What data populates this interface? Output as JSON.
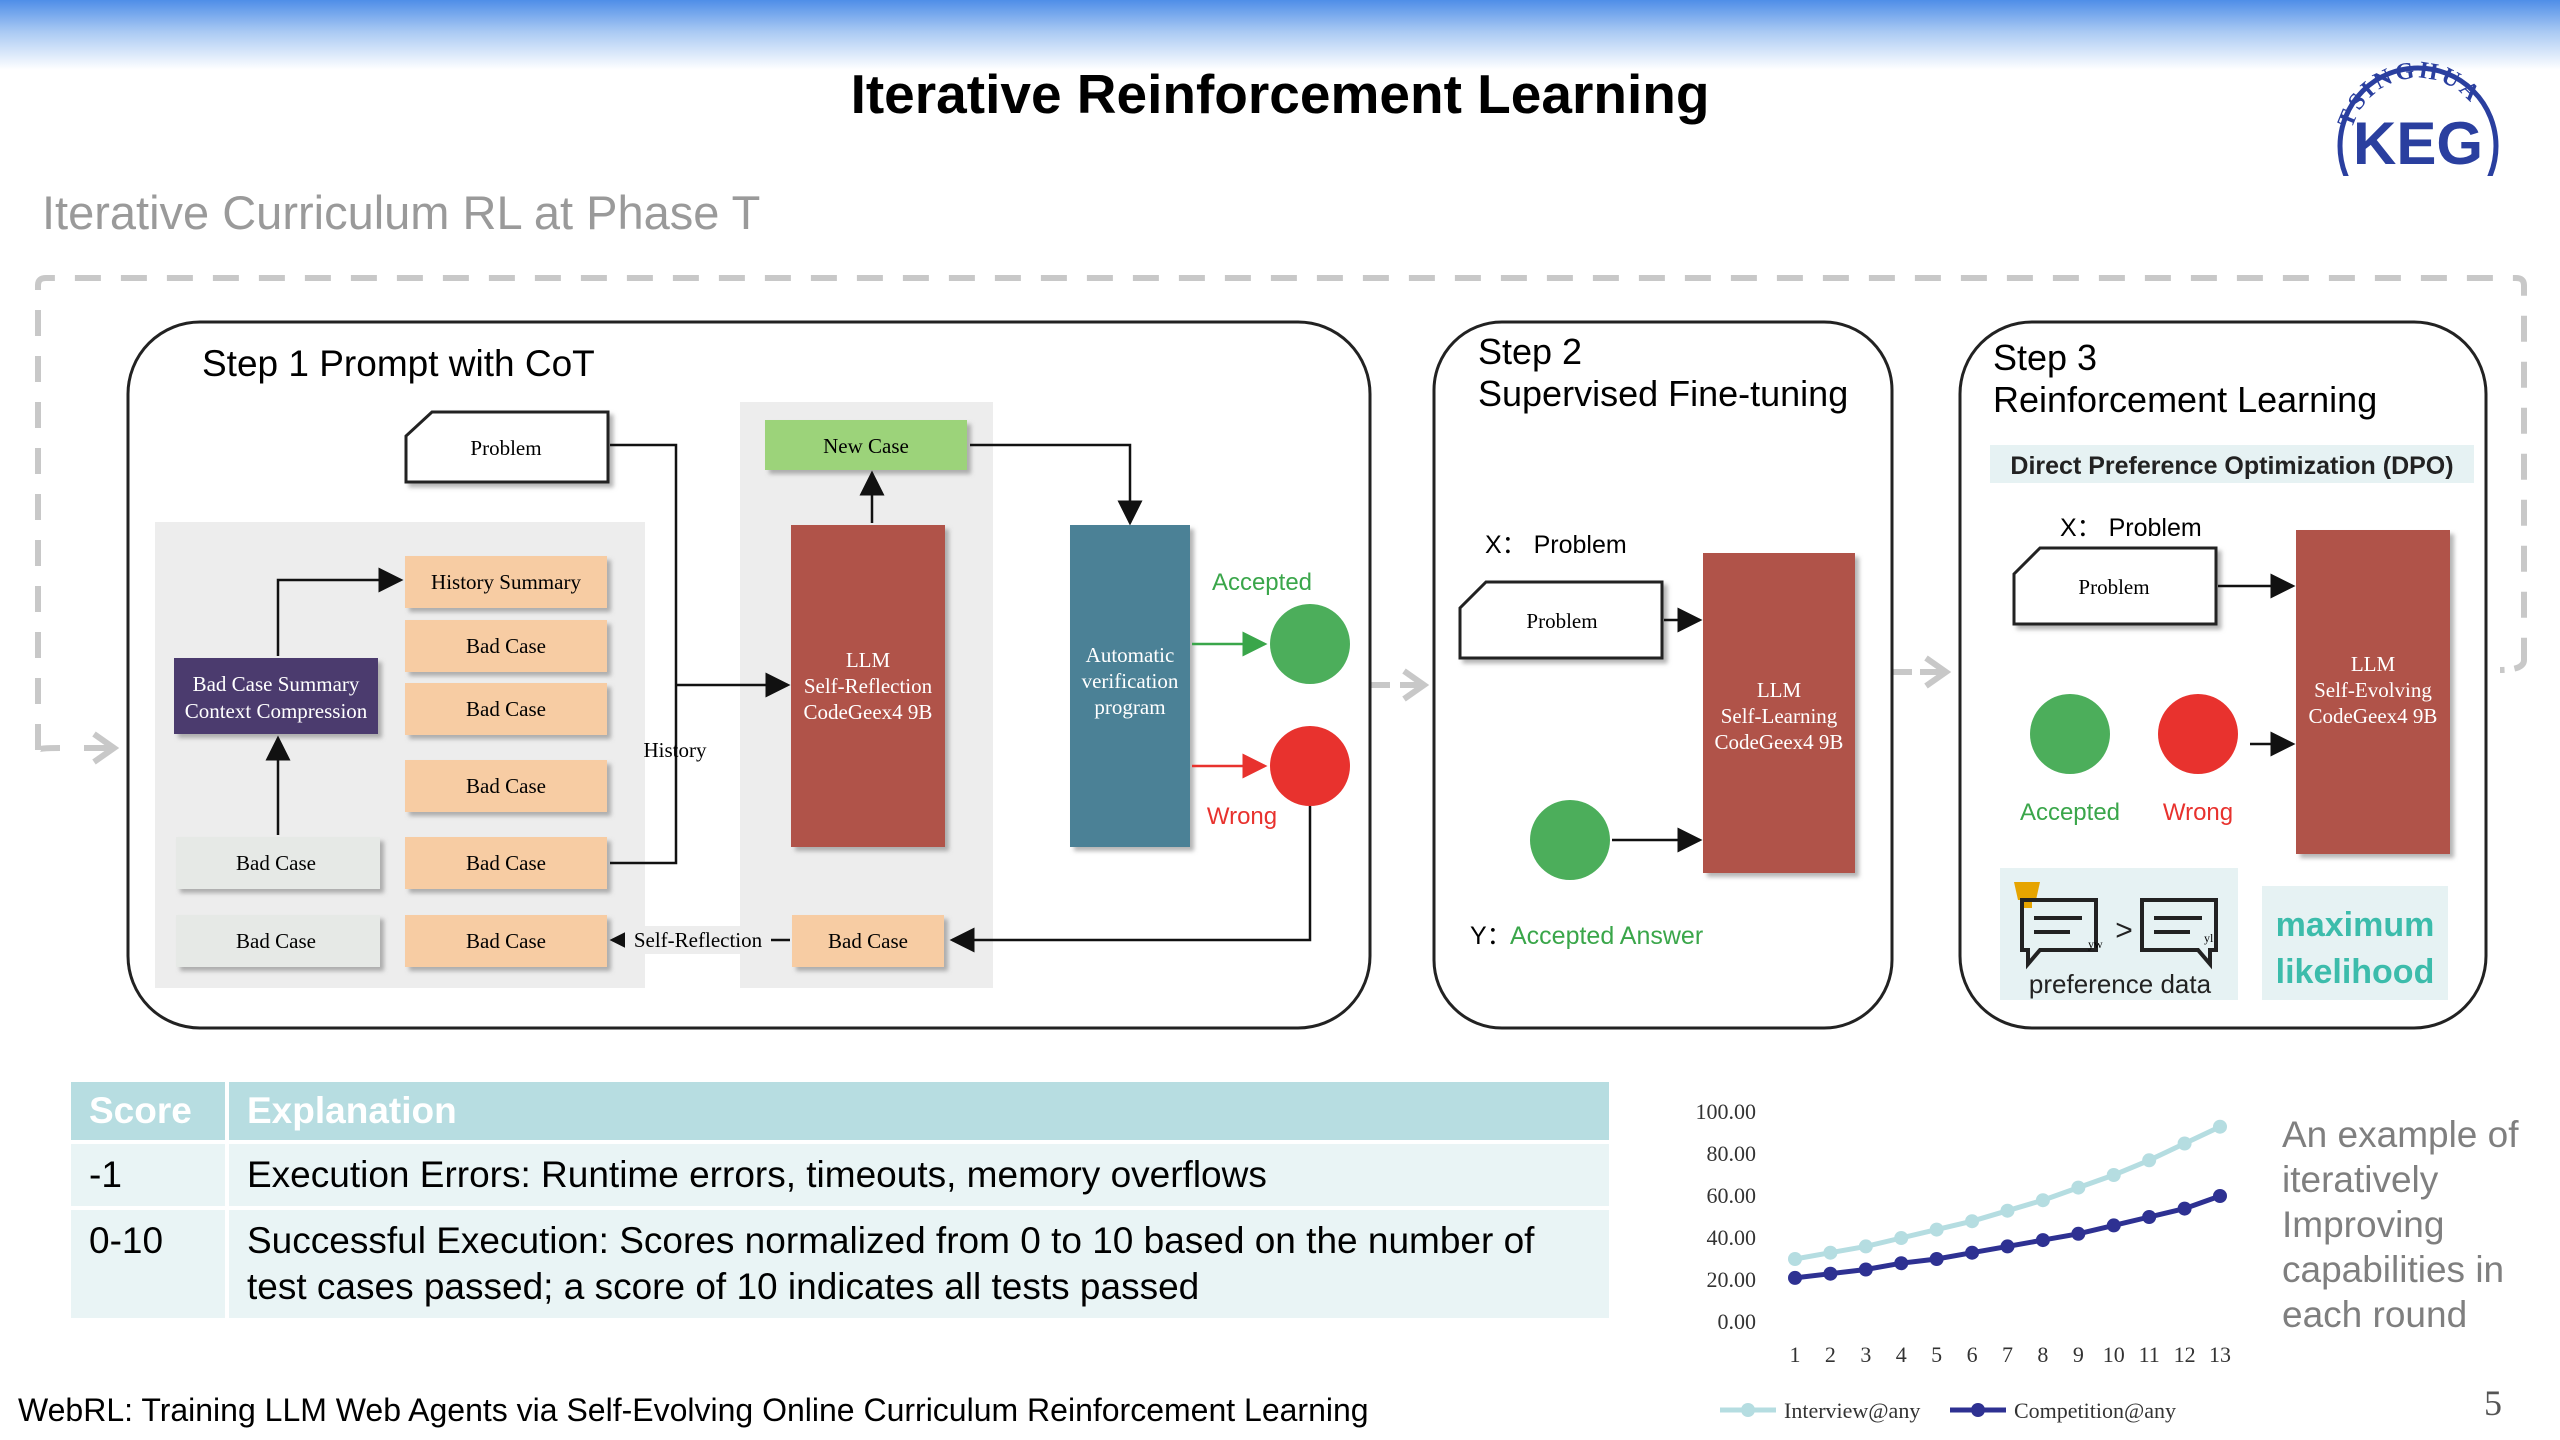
{
  "slide": {
    "title": "Iterative Reinforcement Learning",
    "subtitle": "Iterative Curriculum RL at Phase T",
    "logo_text": "TSINGHUA",
    "logo_mark": "KEG",
    "footer": "WebRL: Training LLM Web Agents via Self-Evolving Online Curriculum Reinforcement Learning",
    "page_number": "5"
  },
  "diagram": {
    "step1": {
      "title": "Step 1  Prompt with CoT",
      "problem": "Problem",
      "history_summary": "History Summary",
      "bad_case": "Bad Case",
      "summary_box_line1": "Bad Case Summary",
      "summary_box_line2": "Context Compression",
      "history_label": "History",
      "new_case": "New Case",
      "llm_line1": "LLM",
      "llm_line2": "Self-Reflection",
      "llm_line3": "CodeGeex4 9B",
      "verify_line1": "Automatic",
      "verify_line2": "verification",
      "verify_line3": "program",
      "accepted": "Accepted",
      "wrong": "Wrong",
      "self_reflection": "Self-Reflection"
    },
    "step2": {
      "title_line1": "Step 2",
      "title_line2": "Supervised Fine-tuning",
      "x_label": "X： Problem",
      "problem": "Problem",
      "llm_line1": "LLM",
      "llm_line2": "Self-Learning",
      "llm_line3": "CodeGeex4 9B",
      "y_prefix": "Y：",
      "y_value": "Accepted Answer"
    },
    "step3": {
      "title_line1": "Step 3",
      "title_line2": "Reinforcement Learning",
      "dpo_label": "Direct Preference Optimization (DPO)",
      "x_label": "X： Problem",
      "problem": "Problem",
      "llm_line1": "LLM",
      "llm_line2": "Self-Evolving",
      "llm_line3": "CodeGeex4 9B",
      "accepted": "Accepted",
      "wrong": "Wrong",
      "pref_label": "preference data",
      "yw": "yw",
      "yl": "yl",
      "ml_line1": "maximum",
      "ml_line2": "likelihood"
    },
    "colors": {
      "llm_red": "#b0534a",
      "verify_teal": "#4b8196",
      "new_case_green": "#9cd37a",
      "bad_case_peach": "#f7cca3",
      "summary_purple": "#4b3a6e",
      "accepted_green": "#4cae5b",
      "wrong_red": "#e8322e"
    }
  },
  "table": {
    "headers": [
      "Score",
      "Explanation"
    ],
    "rows": [
      {
        "score": "-1",
        "explanation": "Execution Errors: Runtime errors, timeouts, memory overflows"
      },
      {
        "score": "0-10",
        "explanation": "Successful Execution: Scores normalized from 0 to 10 based on the number of test cases passed; a score of 10 indicates all tests passed"
      }
    ]
  },
  "chart_data": {
    "type": "line",
    "title": "",
    "xlabel": "",
    "ylabel": "",
    "x": [
      1,
      2,
      3,
      4,
      5,
      6,
      7,
      8,
      9,
      10,
      11,
      12,
      13
    ],
    "y_ticks": [
      "0.00",
      "20.00",
      "40.00",
      "60.00",
      "80.00",
      "100.00"
    ],
    "ylim": [
      0,
      100
    ],
    "grid": false,
    "legend": "bottom",
    "series": [
      {
        "name": "Interview@any",
        "color": "#b5dde1",
        "values": [
          30,
          33,
          36,
          40,
          44,
          48,
          53,
          58,
          64,
          70,
          77,
          85,
          93
        ]
      },
      {
        "name": "Competition@any",
        "color": "#2e3192",
        "values": [
          21,
          23,
          25,
          28,
          30,
          33,
          36,
          39,
          42,
          46,
          50,
          54,
          60
        ]
      }
    ]
  },
  "note": "An example of iteratively Improving capabilities in each round"
}
